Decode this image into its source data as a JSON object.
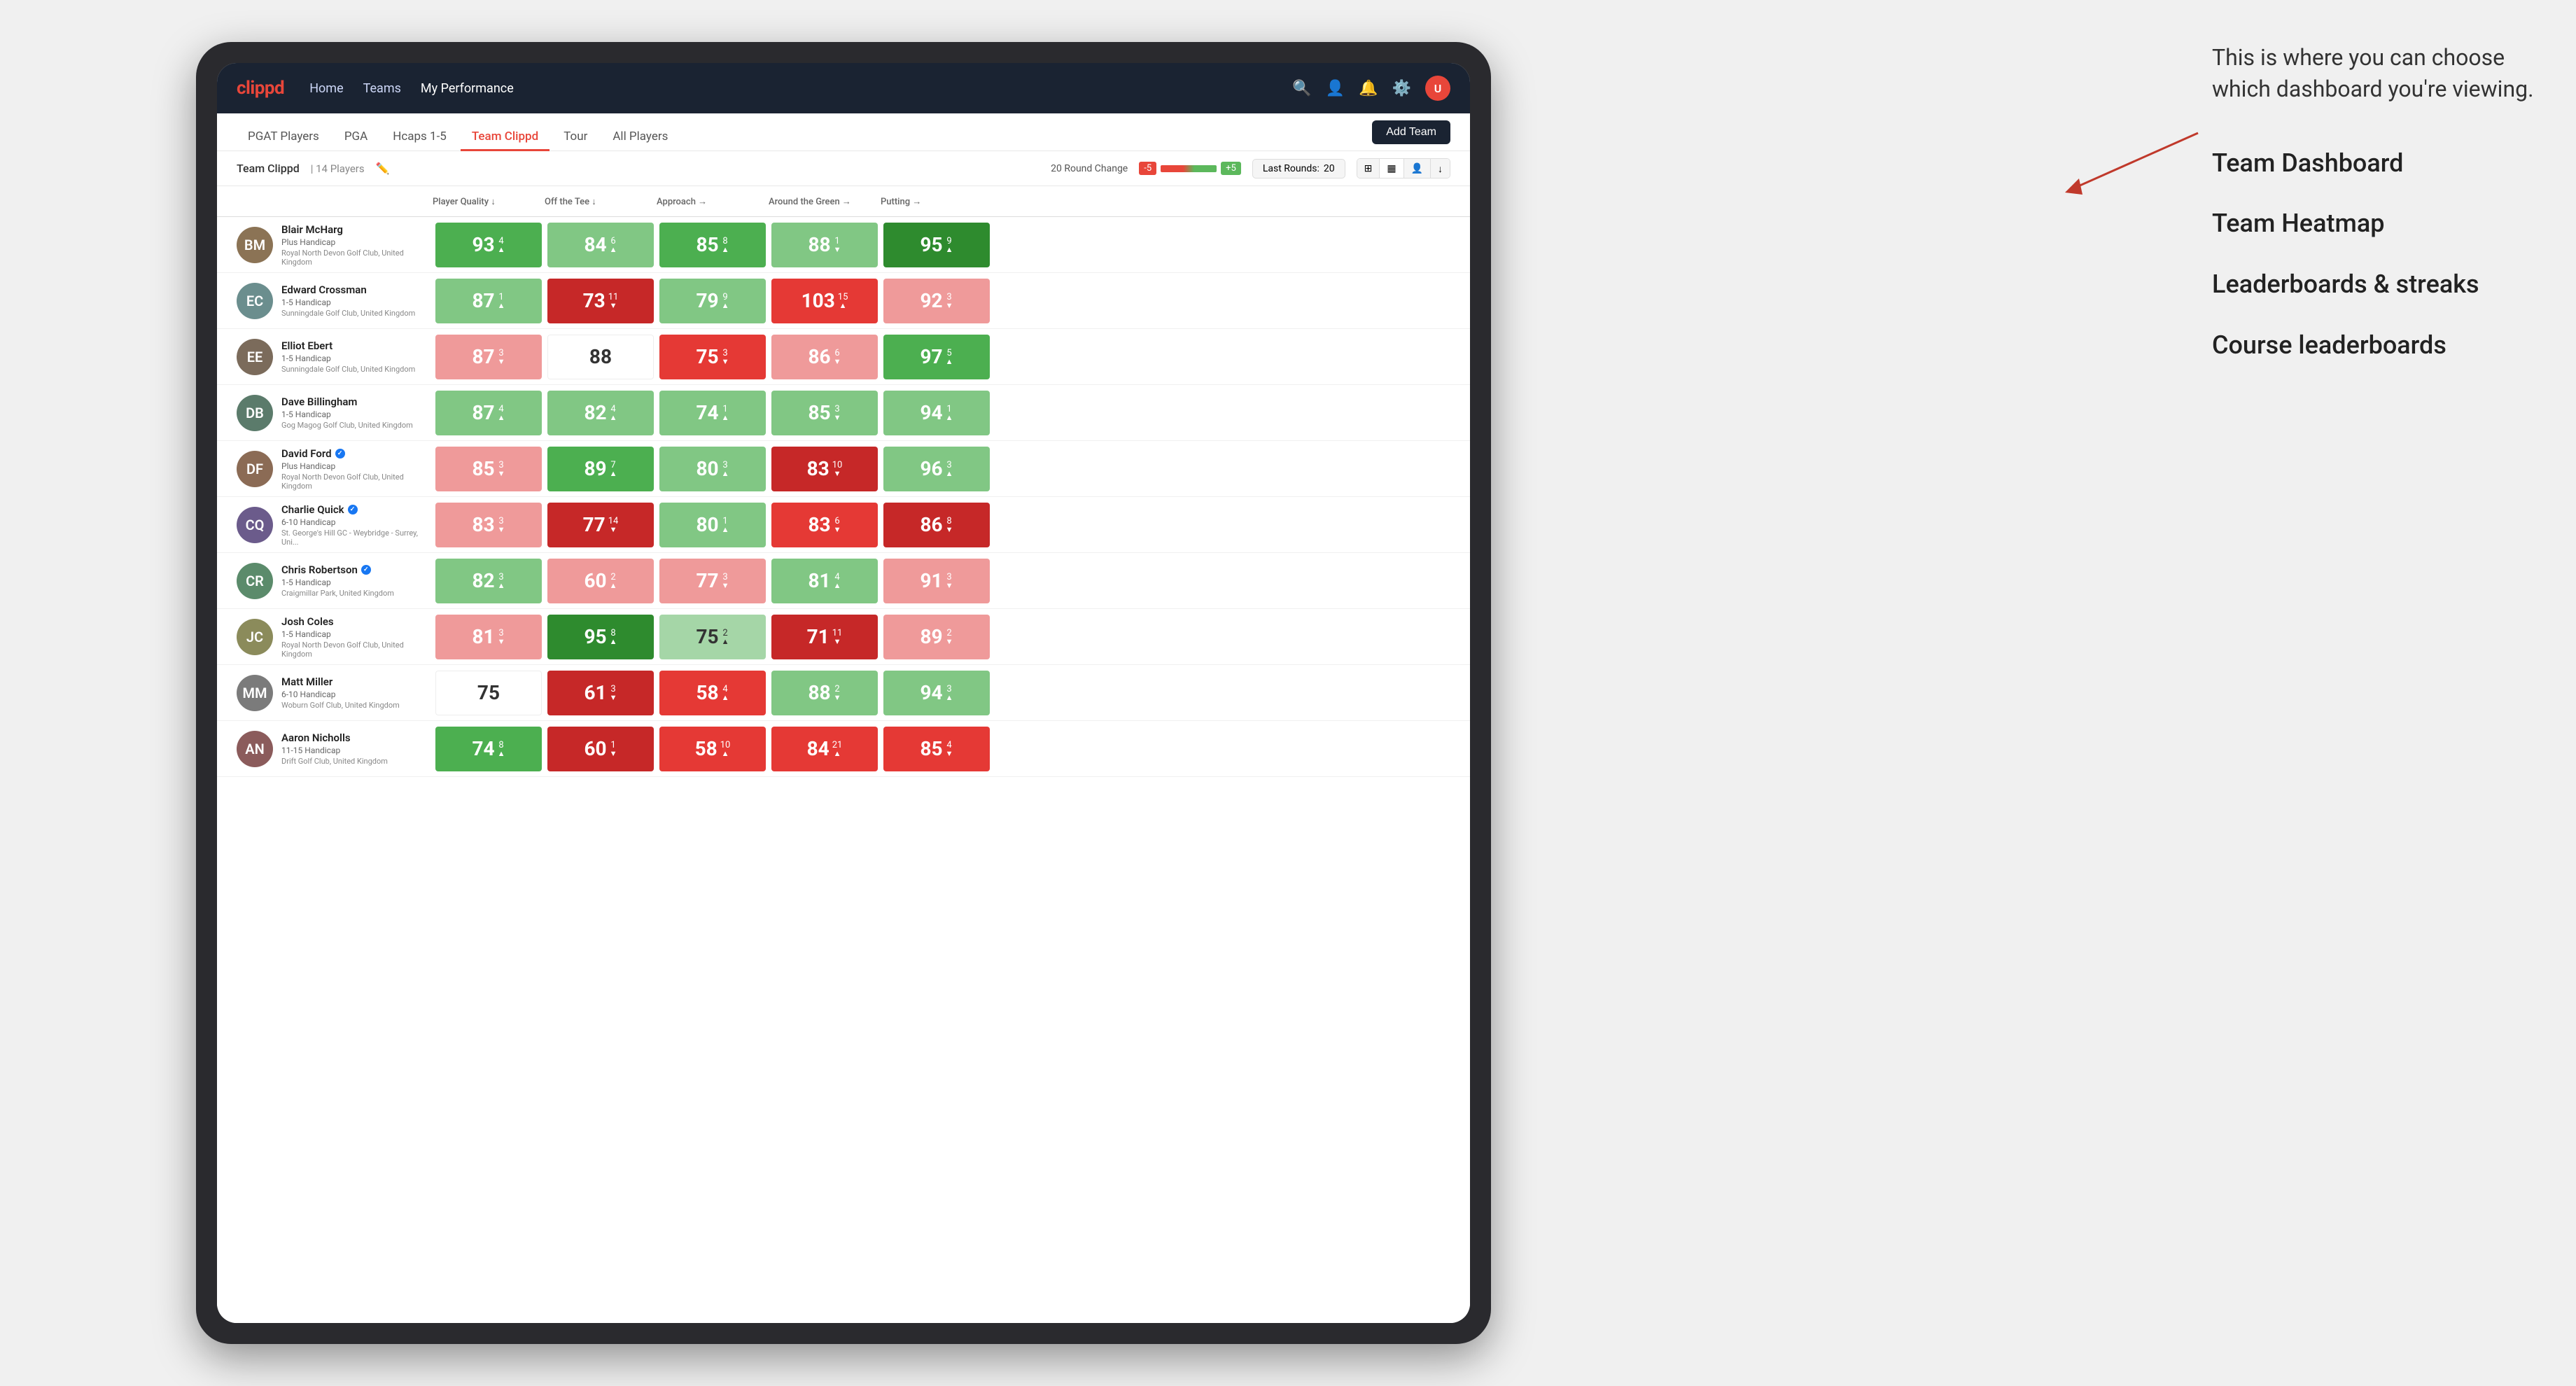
{
  "annotation": {
    "bubble_text": "This is where you can choose which dashboard you're viewing.",
    "list": [
      "Team Dashboard",
      "Team Heatmap",
      "Leaderboards & streaks",
      "Course leaderboards"
    ]
  },
  "navbar": {
    "logo": "clippd",
    "items": [
      "Home",
      "Teams",
      "My Performance"
    ],
    "active_item": "My Performance",
    "icons": [
      "search",
      "person",
      "bell",
      "settings",
      "avatar"
    ]
  },
  "tabs": {
    "items": [
      "PGAT Players",
      "PGA",
      "Hcaps 1-5",
      "Team Clippd",
      "Tour",
      "All Players"
    ],
    "active": "Team Clippd",
    "add_button_label": "Add Team"
  },
  "subheader": {
    "team_name": "Team Clippd",
    "separator": "|",
    "player_count": "14 Players",
    "round_change_label": "20 Round Change",
    "neg_indicator": "-5",
    "pos_indicator": "+5",
    "last_rounds_label": "Last Rounds:",
    "last_rounds_value": "20"
  },
  "table": {
    "columns": [
      "Player Quality ↓",
      "Off the Tee ↓",
      "Approach →",
      "Around the Green →",
      "Putting →"
    ],
    "rows": [
      {
        "name": "Blair McHarg",
        "handicap": "Plus Handicap",
        "club": "Royal North Devon Golf Club, United Kingdom",
        "avatar_text": "BM",
        "avatar_color": "#8B7355",
        "scores": [
          {
            "value": 93,
            "change": "4▲",
            "color": "green-mid"
          },
          {
            "value": 84,
            "change": "6▲",
            "color": "green-light"
          },
          {
            "value": 85,
            "change": "8▲",
            "color": "green-mid"
          },
          {
            "value": 88,
            "change": "1▼",
            "color": "green-light"
          },
          {
            "value": 95,
            "change": "9▲",
            "color": "green-dark"
          }
        ]
      },
      {
        "name": "Edward Crossman",
        "handicap": "1-5 Handicap",
        "club": "Sunningdale Golf Club, United Kingdom",
        "avatar_text": "EC",
        "avatar_color": "#6B8E8E",
        "scores": [
          {
            "value": 87,
            "change": "1▲",
            "color": "green-light"
          },
          {
            "value": 73,
            "change": "11▼",
            "color": "red-dark"
          },
          {
            "value": 79,
            "change": "9▲",
            "color": "green-light"
          },
          {
            "value": 103,
            "change": "15▲",
            "color": "red-mid"
          },
          {
            "value": 92,
            "change": "3▼",
            "color": "red-light"
          }
        ]
      },
      {
        "name": "Elliot Ebert",
        "handicap": "1-5 Handicap",
        "club": "Sunningdale Golf Club, United Kingdom",
        "avatar_text": "EE",
        "avatar_color": "#7B6B5B",
        "scores": [
          {
            "value": 87,
            "change": "3▼",
            "color": "red-light"
          },
          {
            "value": 88,
            "change": "",
            "color": "white"
          },
          {
            "value": 75,
            "change": "3▼",
            "color": "red-mid"
          },
          {
            "value": 86,
            "change": "6▼",
            "color": "red-light"
          },
          {
            "value": 97,
            "change": "5▲",
            "color": "green-mid"
          }
        ]
      },
      {
        "name": "Dave Billingham",
        "handicap": "1-5 Handicap",
        "club": "Gog Magog Golf Club, United Kingdom",
        "avatar_text": "DB",
        "avatar_color": "#5B7B6B",
        "scores": [
          {
            "value": 87,
            "change": "4▲",
            "color": "green-light"
          },
          {
            "value": 82,
            "change": "4▲",
            "color": "green-light"
          },
          {
            "value": 74,
            "change": "1▲",
            "color": "green-light"
          },
          {
            "value": 85,
            "change": "3▼",
            "color": "green-light"
          },
          {
            "value": 94,
            "change": "1▲",
            "color": "green-light"
          }
        ]
      },
      {
        "name": "David Ford",
        "handicap": "Plus Handicap",
        "club": "Royal North Devon Golf Club, United Kingdom",
        "avatar_text": "DF",
        "avatar_color": "#8B6B55",
        "verified": true,
        "scores": [
          {
            "value": 85,
            "change": "3▼",
            "color": "red-light"
          },
          {
            "value": 89,
            "change": "7▲",
            "color": "green-mid"
          },
          {
            "value": 80,
            "change": "3▲",
            "color": "green-light"
          },
          {
            "value": 83,
            "change": "10▼",
            "color": "red-dark"
          },
          {
            "value": 96,
            "change": "3▲",
            "color": "green-light"
          }
        ]
      },
      {
        "name": "Charlie Quick",
        "handicap": "6-10 Handicap",
        "club": "St. George's Hill GC - Weybridge - Surrey, Uni...",
        "avatar_text": "CQ",
        "avatar_color": "#6B5B8B",
        "verified": true,
        "scores": [
          {
            "value": 83,
            "change": "3▼",
            "color": "red-light"
          },
          {
            "value": 77,
            "change": "14▼",
            "color": "red-dark"
          },
          {
            "value": 80,
            "change": "1▲",
            "color": "green-light"
          },
          {
            "value": 83,
            "change": "6▼",
            "color": "red-mid"
          },
          {
            "value": 86,
            "change": "8▼",
            "color": "red-dark"
          }
        ]
      },
      {
        "name": "Chris Robertson",
        "handicap": "1-5 Handicap",
        "club": "Craigmillar Park, United Kingdom",
        "avatar_text": "CR",
        "avatar_color": "#5B8B6B",
        "verified": true,
        "scores": [
          {
            "value": 82,
            "change": "3▲",
            "color": "green-light"
          },
          {
            "value": 60,
            "change": "2▲",
            "color": "red-light"
          },
          {
            "value": 77,
            "change": "3▼",
            "color": "red-light"
          },
          {
            "value": 81,
            "change": "4▲",
            "color": "green-light"
          },
          {
            "value": 91,
            "change": "3▼",
            "color": "red-light"
          }
        ]
      },
      {
        "name": "Josh Coles",
        "handicap": "1-5 Handicap",
        "club": "Royal North Devon Golf Club, United Kingdom",
        "avatar_text": "JC",
        "avatar_color": "#8B8B5B",
        "scores": [
          {
            "value": 81,
            "change": "3▼",
            "color": "red-light"
          },
          {
            "value": 95,
            "change": "8▲",
            "color": "green-dark"
          },
          {
            "value": 75,
            "change": "2▲",
            "color": "light-green"
          },
          {
            "value": 71,
            "change": "11▼",
            "color": "red-dark"
          },
          {
            "value": 89,
            "change": "2▼",
            "color": "red-light"
          }
        ]
      },
      {
        "name": "Matt Miller",
        "handicap": "6-10 Handicap",
        "club": "Woburn Golf Club, United Kingdom",
        "avatar_text": "MM",
        "avatar_color": "#7B7B7B",
        "scores": [
          {
            "value": 75,
            "change": "",
            "color": "white"
          },
          {
            "value": 61,
            "change": "3▼",
            "color": "red-dark"
          },
          {
            "value": 58,
            "change": "4▲",
            "color": "red-mid"
          },
          {
            "value": 88,
            "change": "2▼",
            "color": "green-light"
          },
          {
            "value": 94,
            "change": "3▲",
            "color": "green-light"
          }
        ]
      },
      {
        "name": "Aaron Nicholls",
        "handicap": "11-15 Handicap",
        "club": "Drift Golf Club, United Kingdom",
        "avatar_text": "AN",
        "avatar_color": "#8B5B5B",
        "scores": [
          {
            "value": 74,
            "change": "8▲",
            "color": "green-mid"
          },
          {
            "value": 60,
            "change": "1▼",
            "color": "red-dark"
          },
          {
            "value": 58,
            "change": "10▲",
            "color": "red-mid"
          },
          {
            "value": 84,
            "change": "21▲",
            "color": "red-mid"
          },
          {
            "value": 85,
            "change": "4▼",
            "color": "red-mid"
          }
        ]
      }
    ]
  }
}
